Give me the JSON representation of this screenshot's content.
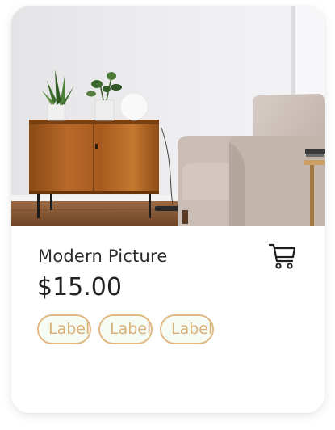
{
  "product": {
    "title": "Modern Picture",
    "price": "$15.00",
    "cart_icon": "cart-icon",
    "labels": [
      "Label",
      "Label",
      "Label"
    ]
  },
  "colors": {
    "label_border": "#e2b982",
    "label_text": "#d9b078",
    "label_fill": "#f6fcf4"
  }
}
